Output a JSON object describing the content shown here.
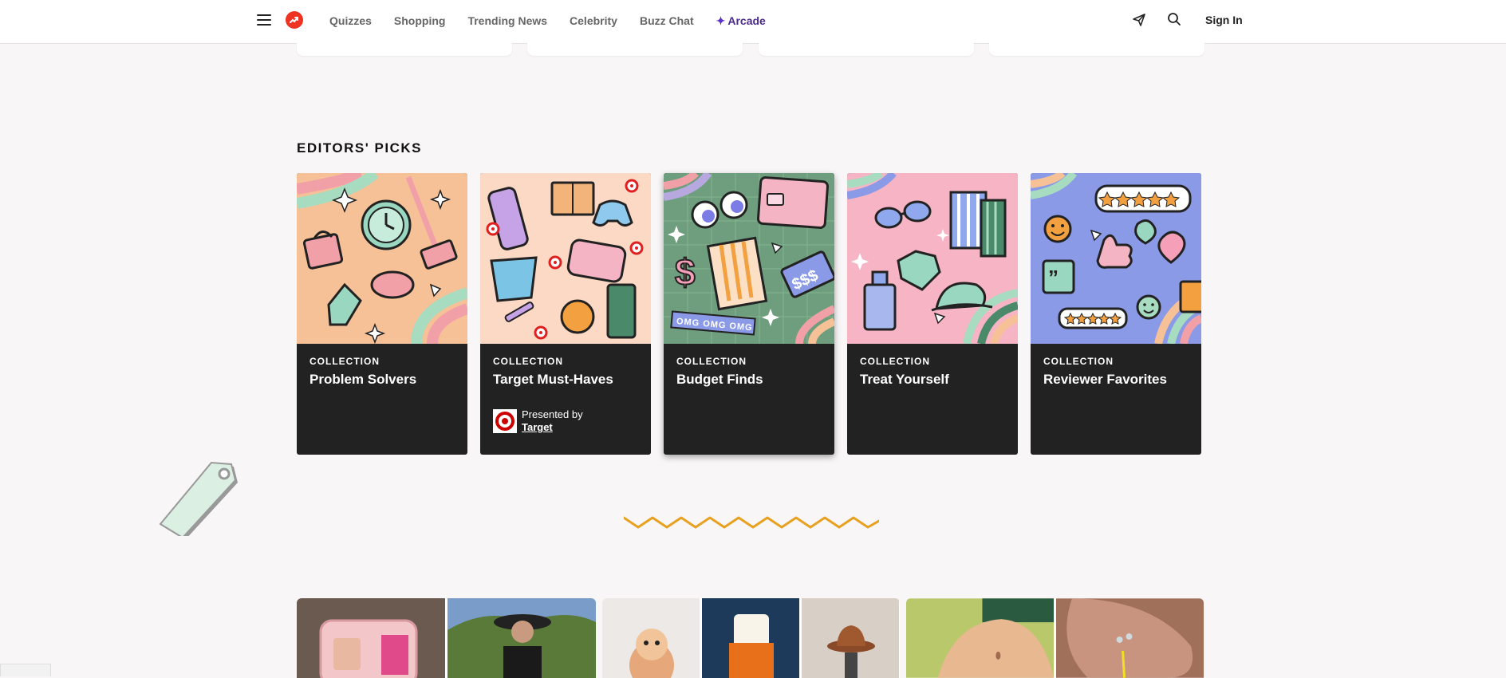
{
  "nav": {
    "items": [
      "Quizzes",
      "Shopping",
      "Trending News",
      "Celebrity",
      "Buzz Chat"
    ],
    "arcade_label": "Arcade",
    "sign_in": "Sign In"
  },
  "editors_picks": {
    "heading": "EDITORS' PICKS",
    "cards": [
      {
        "label": "COLLECTION",
        "title": "Problem Solvers"
      },
      {
        "label": "COLLECTION",
        "title": "Target Must-Haves",
        "presented_by": "Presented by",
        "sponsor": "Target"
      },
      {
        "label": "COLLECTION",
        "title": "Budget Finds"
      },
      {
        "label": "COLLECTION",
        "title": "Treat Yourself"
      },
      {
        "label": "COLLECTION",
        "title": "Reviewer Favorites"
      }
    ]
  },
  "art_text": {
    "omg_banner": "OMG OMG OMG",
    "price_tag": "$$$"
  },
  "colors": {
    "brand_red": "#e32b2b",
    "arcade_purple": "#5b2fc9",
    "card_bg": "#222222",
    "zigzag": "#e8a020"
  }
}
